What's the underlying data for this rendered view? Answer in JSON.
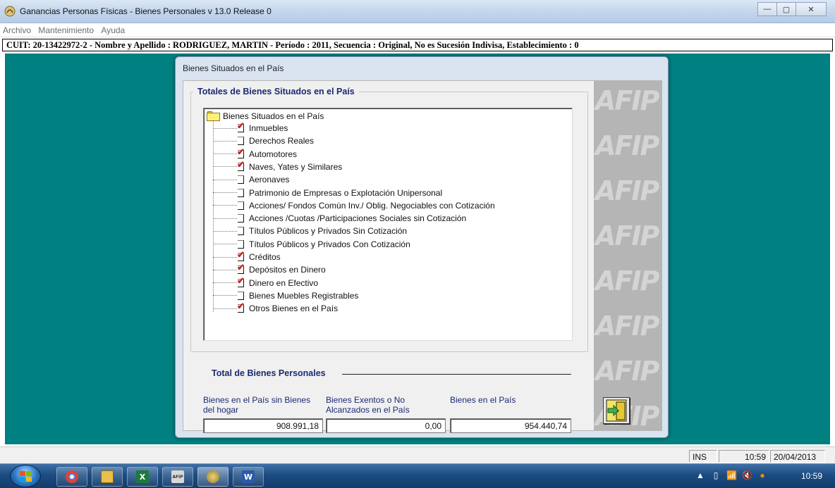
{
  "window": {
    "title": "Ganancias Personas Físicas - Bienes Personales v 13.0 Release 0",
    "controls": {
      "minimize": "—",
      "maximize": "▢",
      "close": "✕"
    }
  },
  "menu": [
    "Archivo",
    "Mantenimiento",
    "Ayuda"
  ],
  "infobar": "CUIT: 20-13422972-2 - Nombre y Apellido : RODRIGUEZ, MARTIN - Período : 2011, Secuencia : Original, No es Sucesión Indivisa, Establecimiento : 0",
  "dialog": {
    "title": "Bienes Situados en el País",
    "group_title": "Totales de Bienes Situados en el País",
    "tree": {
      "root": "Bienes Situados en el País",
      "items": [
        {
          "label": "Inmuebles",
          "checked": true
        },
        {
          "label": "Derechos Reales",
          "checked": false
        },
        {
          "label": "Automotores",
          "checked": true
        },
        {
          "label": "Naves, Yates y Similares",
          "checked": true
        },
        {
          "label": "Aeronaves",
          "checked": false
        },
        {
          "label": "Patrimonio de Empresas o Explotación Unipersonal",
          "checked": false
        },
        {
          "label": "Acciones/ Fondos Común Inv./ Oblig. Negociables con Cotización",
          "checked": false
        },
        {
          "label": "Acciones /Cuotas /Participaciones Sociales sin Cotización",
          "checked": false
        },
        {
          "label": "Títulos Públicos y Privados Sin Cotización",
          "checked": false
        },
        {
          "label": "Títulos Públicos y Privados Con Cotización",
          "checked": false
        },
        {
          "label": "Créditos",
          "checked": true
        },
        {
          "label": "Depósitos en Dinero",
          "checked": true
        },
        {
          "label": "Dinero en Efectivo",
          "checked": true
        },
        {
          "label": "Bienes Muebles Registrables",
          "checked": false
        },
        {
          "label": "Otros Bienes en el País",
          "checked": true
        }
      ]
    },
    "totals": {
      "title": "Total de Bienes Personales",
      "fields": [
        {
          "label": "Bienes en el País sin Bienes del hogar",
          "value": "908.991,18"
        },
        {
          "label": "Bienes Exentos o No Alcanzados en el País",
          "value": "0,00"
        },
        {
          "label": "Bienes en el País",
          "value": "954.440,74"
        }
      ]
    },
    "watermark": "AFIP"
  },
  "status": {
    "mode": "INS",
    "time": "10:59",
    "date": "20/04/2013"
  },
  "taskbar": {
    "apps": [
      "chrome",
      "explorer",
      "excel",
      "afip",
      "aplicativo",
      "word"
    ],
    "excel_glyph": "X",
    "word_glyph": "W",
    "afip_glyph": "AFIP",
    "clock": "10:59"
  },
  "colors": {
    "teal": "#008080",
    "accent_text": "#1b2a72",
    "check": "#cc1f1f"
  }
}
